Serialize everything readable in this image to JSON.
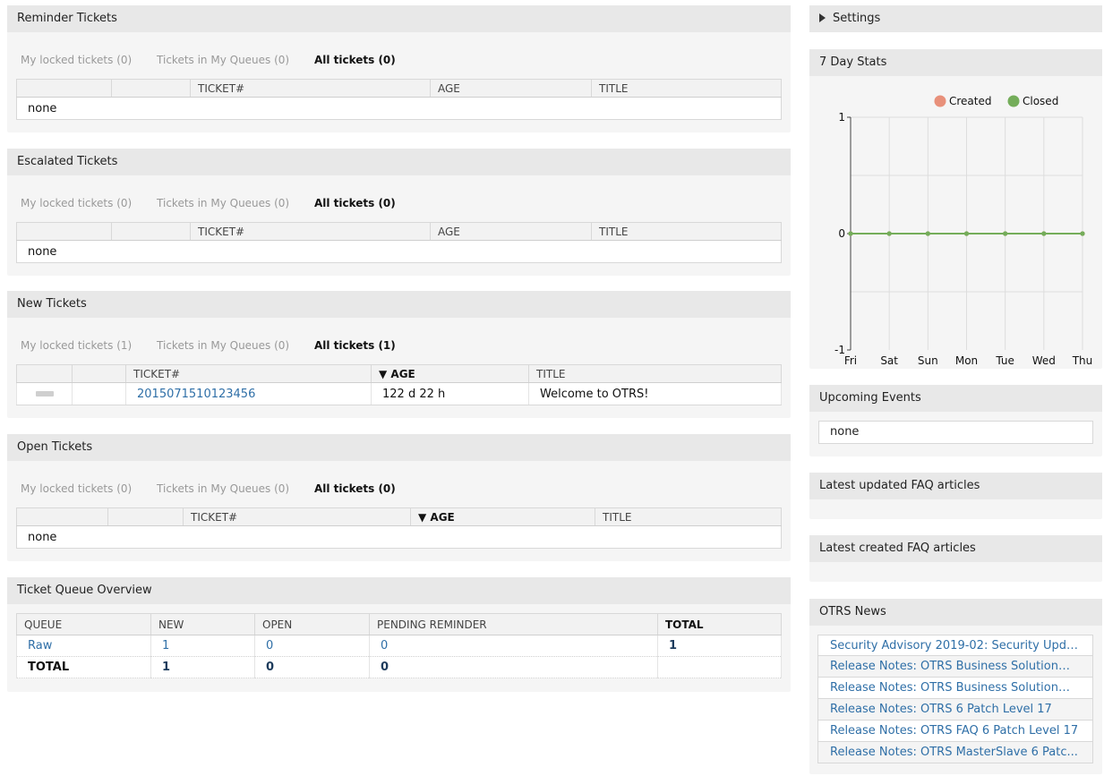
{
  "filters": {
    "my_locked_0": "My locked tickets (0)",
    "my_locked_1": "My locked tickets (1)",
    "my_queues_0": "Tickets in My Queues (0)",
    "all_0": "All tickets (0)",
    "all_1": "All tickets (1)"
  },
  "columns": {
    "ticket": "TICKET#",
    "age": "AGE",
    "age_sorted": "▼ AGE",
    "title": "TITLE"
  },
  "none_text": "none",
  "reminder": {
    "title": "Reminder Tickets"
  },
  "escalated": {
    "title": "Escalated Tickets"
  },
  "new_tickets": {
    "title": "New Tickets",
    "rows": [
      {
        "ticket": "2015071510123456",
        "age": "122 d 22 h",
        "title": "Welcome to OTRS!"
      }
    ]
  },
  "open_tickets": {
    "title": "Open Tickets"
  },
  "queue_overview": {
    "title": "Ticket Queue Overview",
    "headers": [
      "QUEUE",
      "NEW",
      "OPEN",
      "PENDING REMINDER",
      "TOTAL"
    ],
    "rows": [
      {
        "queue": "Raw",
        "new": "1",
        "open": "0",
        "pending": "0",
        "total": "1"
      },
      {
        "queue": "TOTAL",
        "new": "1",
        "open": "0",
        "pending": "0",
        "total": ""
      }
    ]
  },
  "settings": {
    "title": "Settings"
  },
  "stats": {
    "title": "7 Day Stats"
  },
  "chart_data": {
    "type": "line",
    "categories": [
      "Fri",
      "Sat",
      "Sun",
      "Mon",
      "Tue",
      "Wed",
      "Thu"
    ],
    "series": [
      {
        "name": "Created",
        "color": "#e8907a",
        "values": [
          0,
          0,
          0,
          0,
          0,
          0,
          0
        ]
      },
      {
        "name": "Closed",
        "color": "#74ad5a",
        "values": [
          0,
          0,
          0,
          0,
          0,
          0,
          0
        ]
      }
    ],
    "ylim": [
      -1,
      1
    ],
    "yticks": [
      "1",
      "0",
      "-1"
    ],
    "grid": true,
    "legend": "top-right"
  },
  "upcoming": {
    "title": "Upcoming Events",
    "value": "none"
  },
  "faq_updated": {
    "title": "Latest updated FAQ articles"
  },
  "faq_created": {
    "title": "Latest created FAQ articles"
  },
  "news": {
    "title": "OTRS News",
    "items": [
      "Security Advisory 2019-02: Security Upda...",
      "Release Notes: OTRS Business Solution™ ...",
      "Release Notes: OTRS Business Solution™ ...",
      "Release Notes: OTRS 6 Patch Level 17",
      "Release Notes: OTRS FAQ 6 Patch Level 17",
      "Release Notes: OTRS MasterSlave 6 Patc..."
    ]
  }
}
